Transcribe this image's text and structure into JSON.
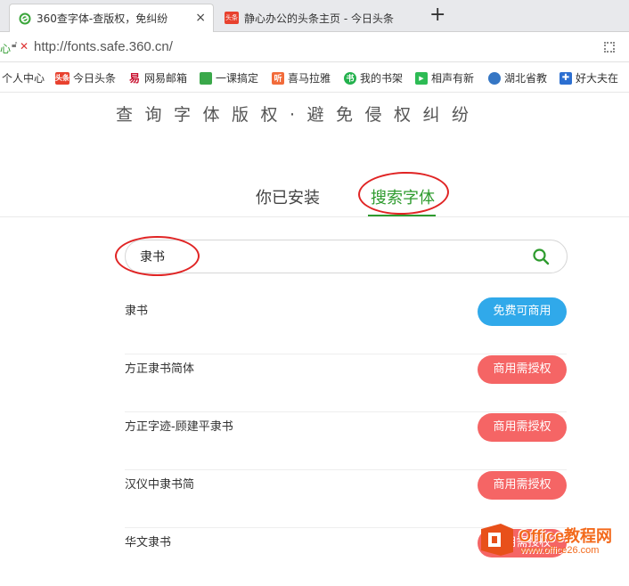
{
  "browser": {
    "tabs": [
      {
        "title": "360查字体-查版权，免纠纷",
        "favicon": "360-logo-icon",
        "close": "×"
      },
      {
        "title": "静心办公的头条主页 - 今日头条",
        "favicon": "toutiao-icon",
        "favicon_text": "头条"
      }
    ],
    "new_tab": "+",
    "address": {
      "security_text": "心",
      "security_x": "✕",
      "url": "http://fonts.safe.360.cn/"
    },
    "bookmarks": [
      {
        "label": "个人中心",
        "icon": "none",
        "color": ""
      },
      {
        "label": "今日头条",
        "icon": "toutiao-icon",
        "icon_text": "头条",
        "color": "#e8412e"
      },
      {
        "label": "网易邮箱",
        "icon": "netease-mail-icon",
        "icon_text": "易",
        "color": "#c8102e"
      },
      {
        "label": "一课搞定",
        "icon": "book-icon",
        "icon_text": "",
        "color": "#3aa84a"
      },
      {
        "label": "喜马拉雅",
        "icon": "ximalaya-icon",
        "icon_text": "听",
        "color": "#f26b3a"
      },
      {
        "label": "我的书架",
        "icon": "bookshelf-icon",
        "icon_text": "书",
        "color": "#23b14d"
      },
      {
        "label": "相声有新",
        "icon": "video-icon",
        "icon_text": "▶",
        "color": "#2dbb54"
      },
      {
        "label": "湖北省教",
        "icon": "globe-icon",
        "icon_text": "",
        "color": "#3576c4"
      },
      {
        "label": "好大夫在",
        "icon": "hospital-icon",
        "icon_text": "✚",
        "color": "#2c6fd1"
      }
    ]
  },
  "page": {
    "slogan": "查询字体版权·避免侵权纠纷",
    "tabs": [
      {
        "label": "你已安装",
        "active": false
      },
      {
        "label": "搜索字体",
        "active": true
      }
    ],
    "search": {
      "value": "隶书",
      "placeholder": ""
    },
    "results": [
      {
        "name": "隶书",
        "status": "免费可商用",
        "type": "free"
      },
      {
        "name": "方正隶书简体",
        "status": "商用需授权",
        "type": "paid"
      },
      {
        "name": "方正字迹-顾建平隶书",
        "status": "商用需授权",
        "type": "paid"
      },
      {
        "name": "汉仪中隶书简",
        "status": "商用需授权",
        "type": "paid"
      },
      {
        "name": "华文隶书",
        "status": "商用需授权",
        "type": "paid"
      }
    ]
  },
  "watermark": {
    "brand": "Office教程网",
    "site": "www.office26.com"
  },
  "colors": {
    "accent": "#2e9b2e",
    "free": "#30a9ea",
    "paid": "#f56565",
    "annotation": "#e02424"
  }
}
